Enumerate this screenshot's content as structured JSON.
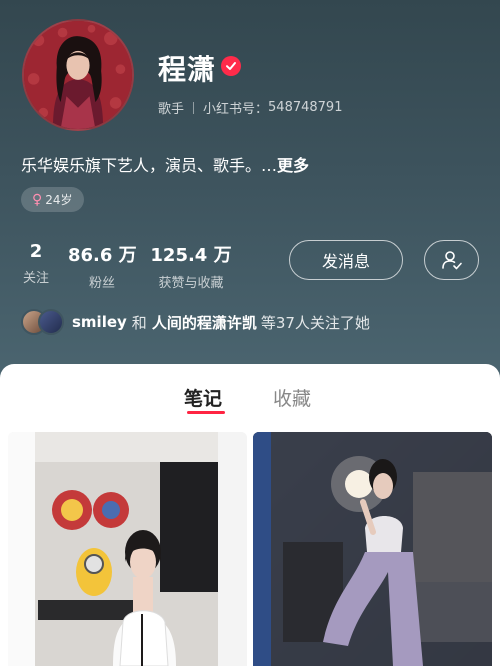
{
  "profile": {
    "name": "程潇",
    "role": "歌手",
    "red_id_label": "小红书号：",
    "red_id": "548748791",
    "bio": "乐华娱乐旗下艺人，演员、歌手。…",
    "bio_more": "更多",
    "age_tag": "24岁",
    "gender_symbol": "♀"
  },
  "stats": [
    {
      "value": "2",
      "label": "关注"
    },
    {
      "value": "86.6 万",
      "label": "粉丝"
    },
    {
      "value": "125.4 万",
      "label": "获赞与收藏"
    }
  ],
  "actions": {
    "message_label": "发消息"
  },
  "followers_row": {
    "user1": "smiley",
    "and": "和",
    "user2": "人间的程潇许凯",
    "suffix": "等37人关注了她"
  },
  "tabs": [
    {
      "label": "笔记",
      "active": true
    },
    {
      "label": "收藏",
      "active": false
    }
  ],
  "colors": {
    "accent": "#ff2442",
    "header_bg": "#3f5560"
  }
}
